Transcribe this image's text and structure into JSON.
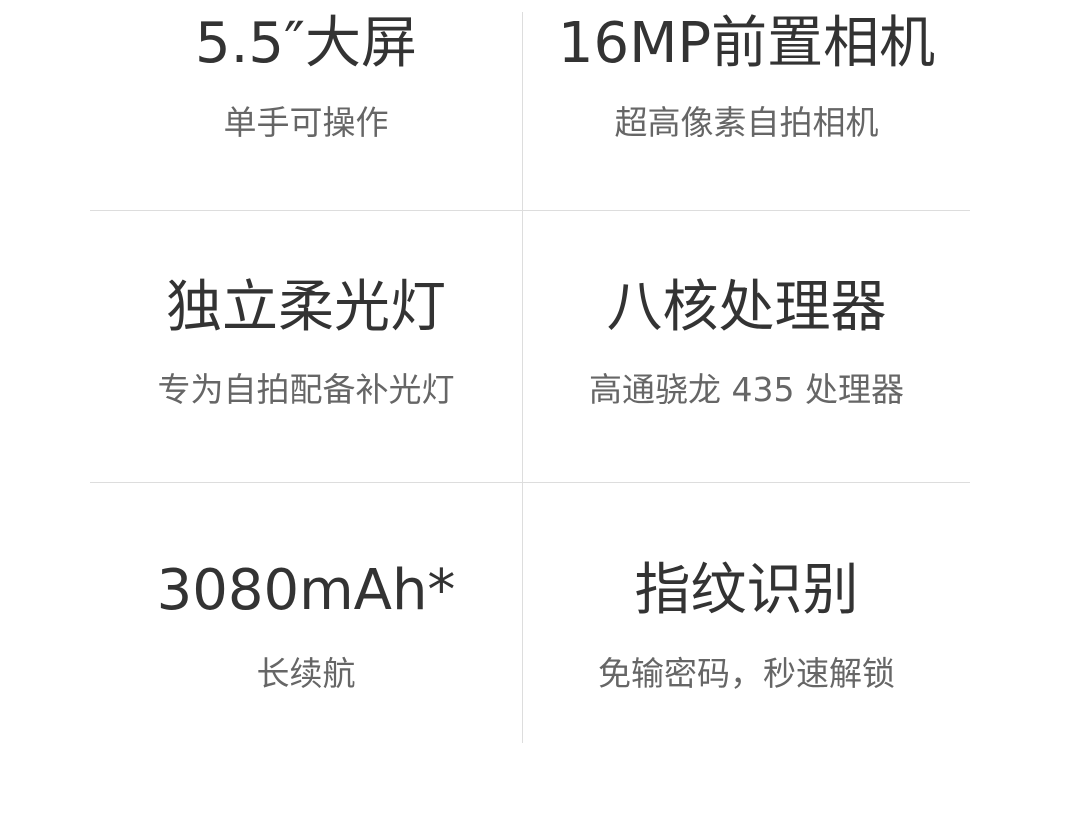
{
  "features": [
    {
      "title": "5.5″大屏",
      "subtitle": "单手可操作"
    },
    {
      "title": "16MP前置相机",
      "subtitle": "超高像素自拍相机"
    },
    {
      "title": "独立柔光灯",
      "subtitle": "专为自拍配备补光灯"
    },
    {
      "title": "八核处理器",
      "subtitle": "高通骁龙 435 处理器"
    },
    {
      "title": "3080mAh*",
      "subtitle": "长续航"
    },
    {
      "title": "指纹识别",
      "subtitle": "免输密码，秒速解锁"
    }
  ]
}
